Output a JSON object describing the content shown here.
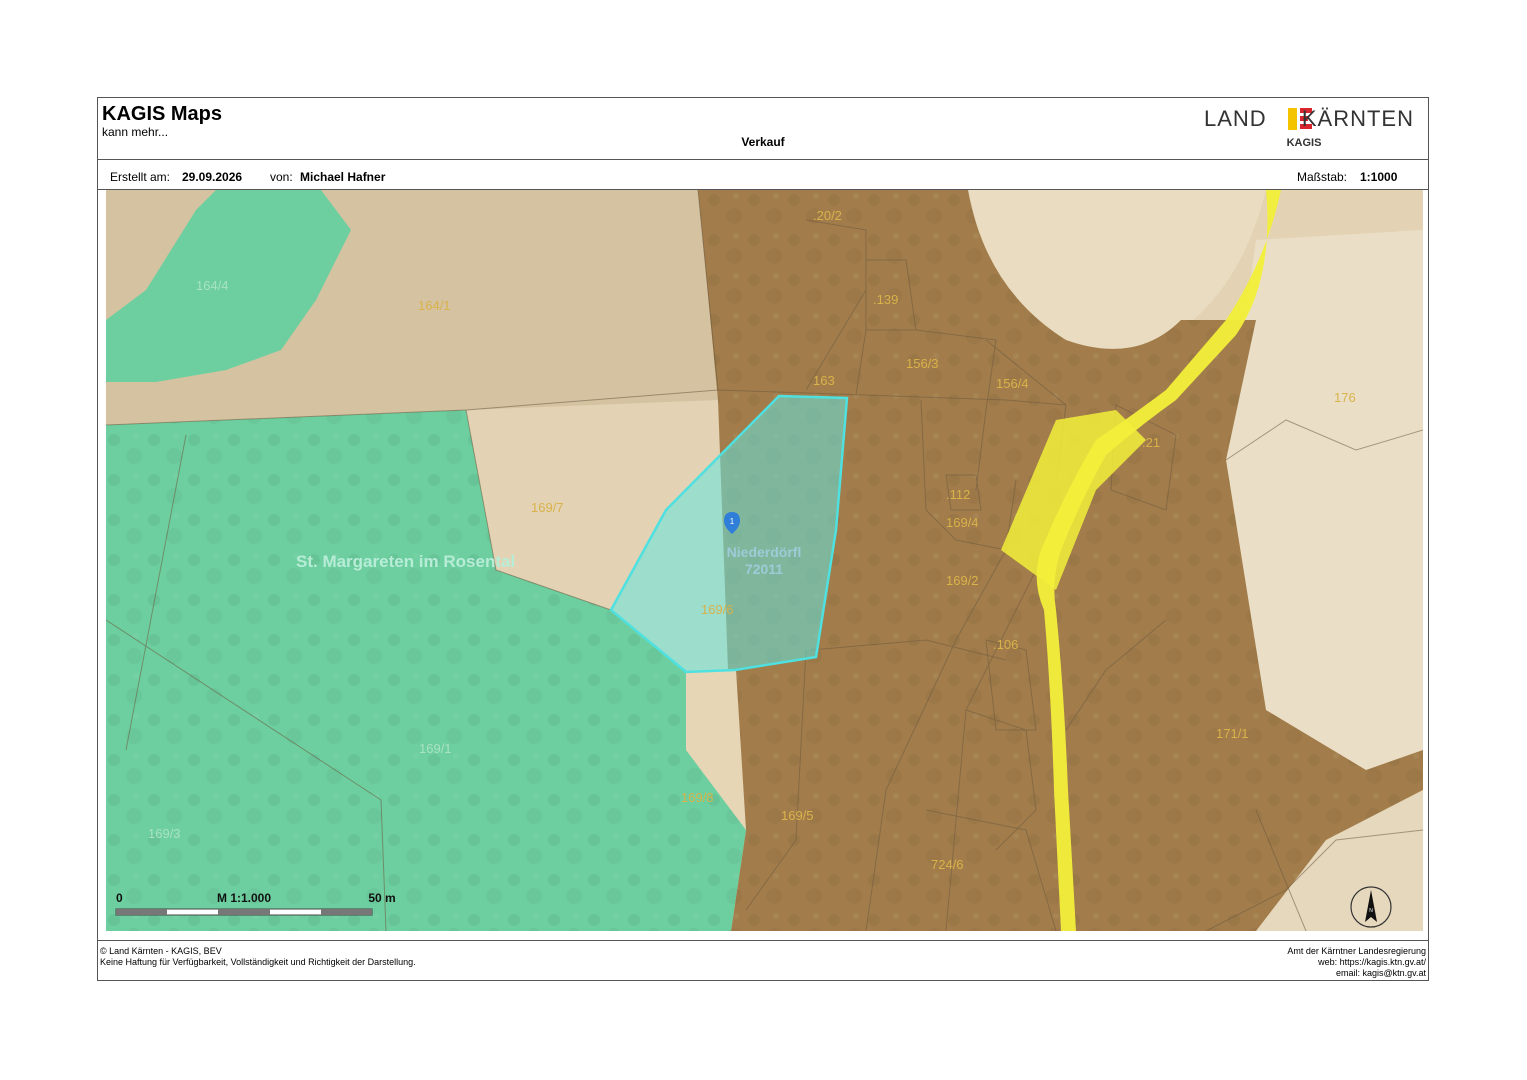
{
  "header": {
    "app_title": "KAGIS Maps",
    "app_subtitle": "kann mehr...",
    "doc_title": "Verkauf",
    "logo_left": "LAND",
    "logo_right": "KÄRNTEN",
    "logo_sub": "KAGIS"
  },
  "meta": {
    "created_label": "Erstellt am:",
    "created_value": "29.09.2026",
    "author_label": "von:",
    "author_value": "Michael Hafner",
    "scale_label": "Maßstab:",
    "scale_value": "1:1000"
  },
  "map": {
    "colors": {
      "green_zone": "#6dcf9f",
      "brown_zone": "#a07a48",
      "light_zone": "#e7d9bd",
      "road": "#f2ef3a",
      "selection": "#63e6e0"
    },
    "parcels": [
      ".20/2",
      "164/4",
      "164/1",
      ".139",
      "163",
      "156/3",
      "156/4",
      "176",
      ".21",
      ".112",
      "169/4",
      "169/7",
      "169/2",
      "169/6",
      ".106",
      "169/1",
      "171/1",
      "169/8",
      "169/5",
      "169/3",
      "724/6"
    ],
    "place_name": "St. Margareten im Rosental",
    "locality_name": "Niederdörfl",
    "locality_code": "72011",
    "marker_label": "1",
    "scalebar": {
      "start": "0",
      "middle": "M 1:1.000",
      "end": "50 m"
    },
    "north_label": "N"
  },
  "footer": {
    "left_line1": "© Land Kärnten - KAGIS, BEV",
    "left_line2": "Keine Haftung für Verfügbarkeit, Vollständigkeit und Richtigkeit der Darstellung.",
    "right_line1": "Amt der Kärntner Landesregierung",
    "right_line2": "web: https://kagis.ktn.gv.at/",
    "right_line3": "email: kagis@ktn.gv.at"
  }
}
